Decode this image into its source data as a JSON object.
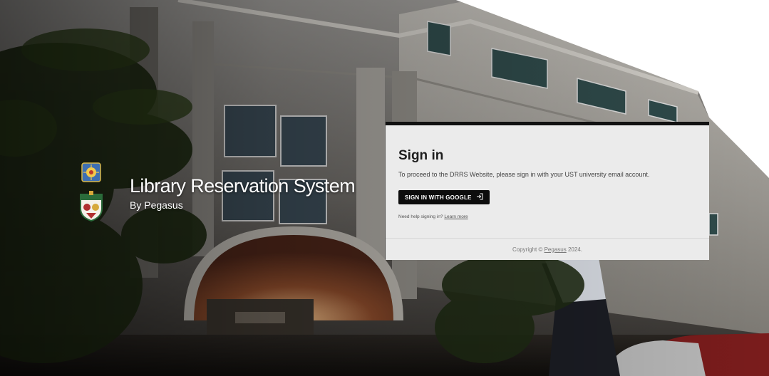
{
  "brand": {
    "title": "Library Reservation System",
    "subtitle": "By Pegasus",
    "logos": [
      "ust-seal-icon",
      "ust-crest-icon"
    ]
  },
  "signin": {
    "title": "Sign in",
    "description": "To proceed to the DRRS Website, please sign in with your UST university email account.",
    "google_button_label": "SIGN IN WITH GOOGLE",
    "google_button_icon": "sign-in-arrow-icon",
    "help_text": "Need help signing in?",
    "help_link": "Learn more"
  },
  "footer": {
    "prefix": "Copyright ©",
    "link": "Pegasus",
    "suffix": "2024."
  },
  "colors": {
    "card_background": "#ebebeb",
    "card_top_border": "#111111",
    "button_background": "#0d0d0d",
    "button_text": "#ffffff"
  }
}
